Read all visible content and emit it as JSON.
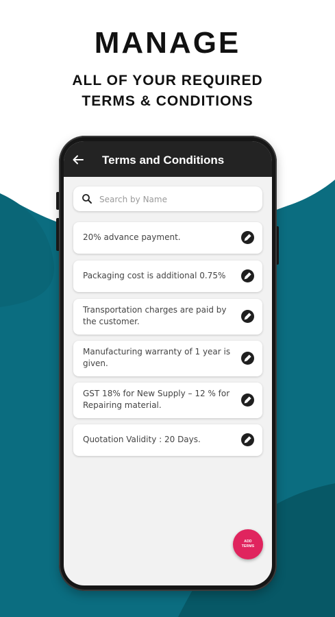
{
  "promo": {
    "headline": "MANAGE",
    "subline_1": "ALL OF YOUR REQUIRED",
    "subline_2": "TERMS & CONDITIONS"
  },
  "colors": {
    "teal": "#0b6d80",
    "teal_dark": "#075866",
    "app_bar": "#232323",
    "fab": "#e0245e"
  },
  "app_bar": {
    "title": "Terms and Conditions",
    "back_icon": "arrow-left-icon"
  },
  "search": {
    "placeholder": "Search by Name",
    "value": "",
    "icon": "search-icon"
  },
  "terms": [
    {
      "text": "20% advance payment.",
      "icon": "edit-icon"
    },
    {
      "text": "Packaging cost is additional 0.75%",
      "icon": "edit-icon"
    },
    {
      "text": "Transportation charges are paid by the customer.",
      "icon": "edit-icon"
    },
    {
      "text": "Manufacturing warranty of 1 year is given.",
      "icon": "edit-icon"
    },
    {
      "text": "GST 18% for New Supply – 12 % for Repairing material.",
      "icon": "edit-icon"
    },
    {
      "text": "Quotation Validity : 20 Days.",
      "icon": "edit-icon"
    }
  ],
  "fab": {
    "label": "ADD TERMS"
  }
}
